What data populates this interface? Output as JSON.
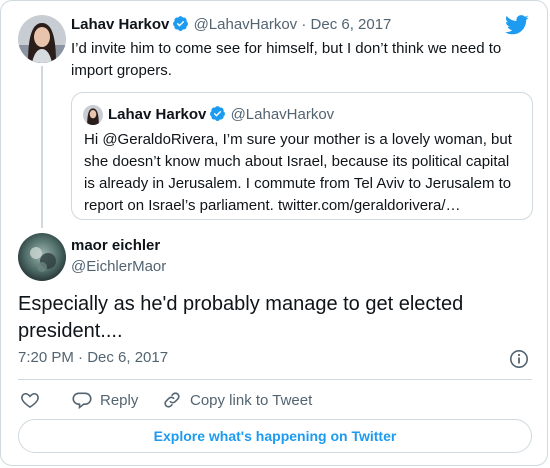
{
  "parent_tweet": {
    "author_name": "Lahav Harkov",
    "author_handle": "@LahavHarkov",
    "separator": "·",
    "date": "Dec 6, 2017",
    "text": "I’d invite him to come see for himself, but I don’t think we need to import gropers."
  },
  "quoted_tweet": {
    "author_name": "Lahav Harkov",
    "author_handle": "@LahavHarkov",
    "text": "Hi @GeraldoRivera, I’m sure your mother is a lovely woman, but she doesn’t know much about Israel, because its political capital is already in Jerusalem. I commute from Tel Aviv to Jerusalem to report on Israel’s parliament. twitter.com/geraldorivera/…"
  },
  "main_tweet": {
    "author_name": "maor eichler",
    "author_handle": "@EichlerMaor",
    "text": "Especially as he'd probably manage to get elected president....",
    "time": "7:20 PM · Dec 6, 2017"
  },
  "actions": {
    "like_icon": "heart-icon",
    "reply_label": "Reply",
    "copy_link_label": "Copy link to Tweet"
  },
  "explore_label": "Explore what's happening on Twitter",
  "colors": {
    "accent": "#1d9bf0",
    "text": "#0f1419",
    "muted": "#536471",
    "border": "#cfd9de"
  }
}
